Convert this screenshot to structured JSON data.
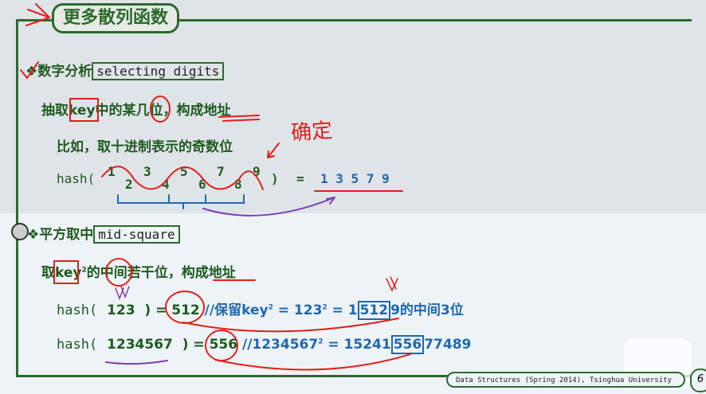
{
  "title": "更多散列函数",
  "section1": {
    "heading_cn": "数字分析",
    "heading_en": "selecting digits",
    "line1": {
      "pre": "抽取",
      "key": "key",
      "post": "中的某几位，构成地址"
    },
    "line2": "比如，取十进制表示的奇数位",
    "hash_fn": "hash(",
    "odd_digits": [
      "1",
      "3",
      "5",
      "7",
      "9"
    ],
    "even_digits": [
      "2",
      "4",
      "6",
      "8"
    ],
    "close": ")",
    "eq": "=",
    "result": "1 3 5 7 9"
  },
  "section2": {
    "heading_cn": "平方取中",
    "heading_en": "mid-square",
    "line1": {
      "pre": "取",
      "key": "key",
      "sup": "2",
      "post": "的中间若干位，构成地址"
    },
    "ex1": {
      "fn": "hash(",
      "arg": "123",
      "close": ")",
      "eq": "=",
      "result": "512",
      "comment_pre": "//保留key",
      "sup": "2",
      "c_eq1": " = 123",
      "c_sup": "2",
      "c_eq2": " = 1",
      "boxed": "512",
      "tail": "9的中间3位"
    },
    "ex2": {
      "fn": "hash(",
      "arg": "1234567",
      "close": ")",
      "eq": "=",
      "result": "556",
      "comment_pre": "//1234567",
      "sup": "2",
      "c_eq": " = 15241",
      "boxed": "556",
      "tail": "77489"
    }
  },
  "annotation": "确定",
  "footer": "Data Structures (Spring 2014), Tsinghua University",
  "page_number": "6",
  "colors": {
    "green": "#2d6a2d",
    "blue": "#1f68b0",
    "ink": "#e0201a"
  }
}
